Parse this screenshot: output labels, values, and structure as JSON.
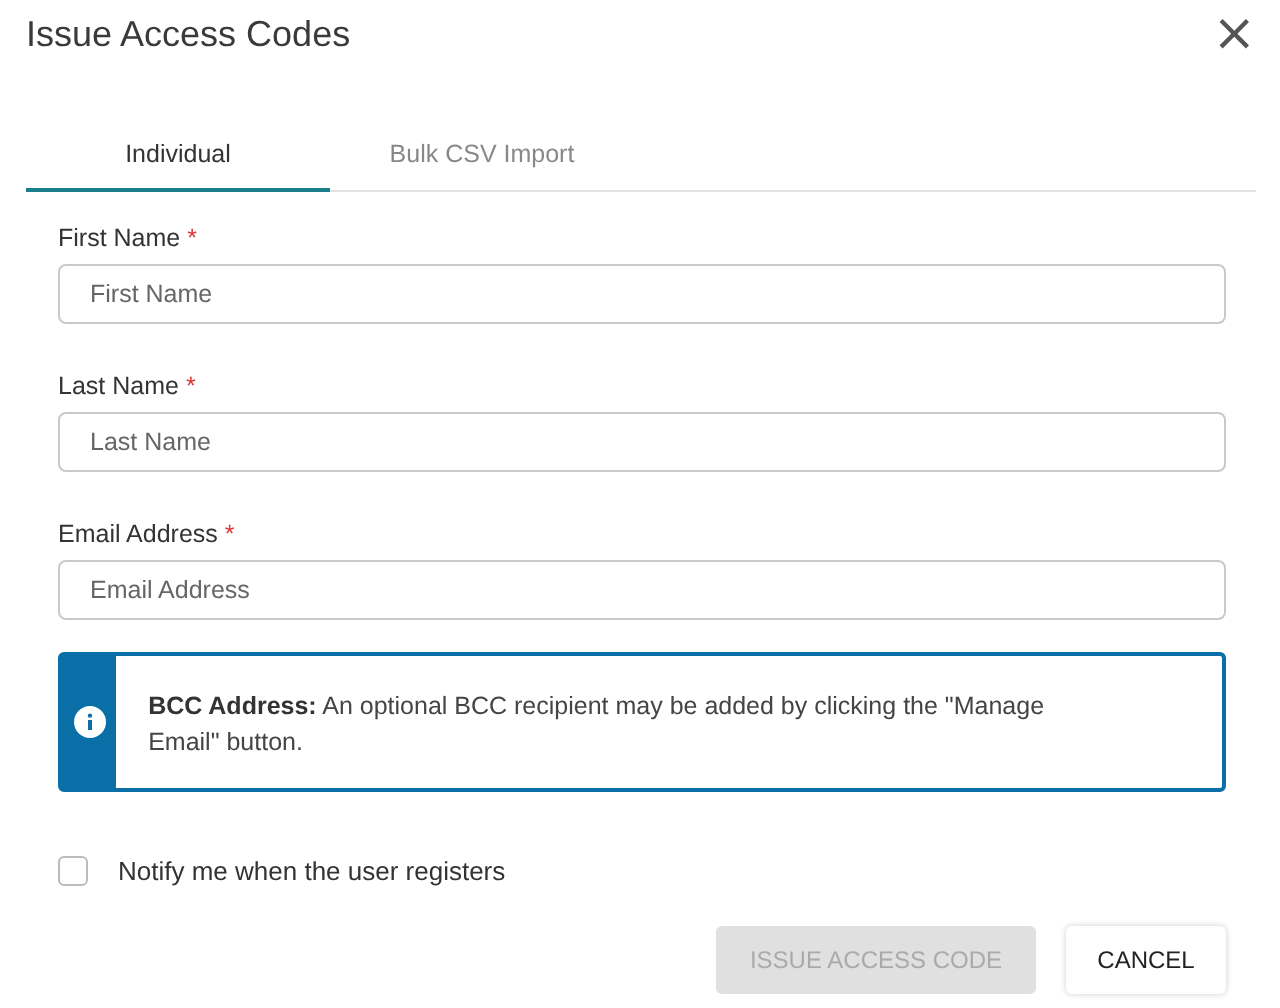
{
  "dialog": {
    "title": "Issue Access Codes",
    "close": "×"
  },
  "tabs": [
    {
      "label": "Individual",
      "selected": true
    },
    {
      "label": "Bulk CSV Import",
      "selected": false
    }
  ],
  "fields": [
    {
      "label": "First Name",
      "required_mark": "*",
      "placeholder": "First Name"
    },
    {
      "label": "Last Name",
      "required_mark": "*",
      "placeholder": "Last Name"
    },
    {
      "label": "Email Address",
      "required_mark": "*",
      "placeholder": "Email Address"
    }
  ],
  "info": {
    "text": "**BCC Address:** An optional BCC recipient may be added by clicking the \"Manage Email\" button."
  },
  "notify": {
    "label": "Notify me when the user registers",
    "checked": false
  },
  "buttons": [
    {
      "label": "ISSUE ACCESS CODE",
      "kind": "primary",
      "disabled": true
    },
    {
      "label": "CANCEL",
      "kind": "secondary",
      "disabled": false
    }
  ]
}
